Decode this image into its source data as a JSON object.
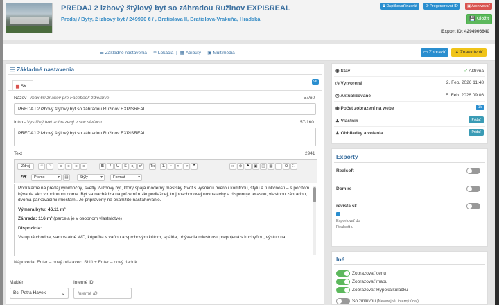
{
  "header": {
    "title": "PREDAJ 2 izbový štýlový byt so záhradou Ružinov EXPISREAL",
    "subtitle": "Predaj / Byty, 2 izbový byt / 249990 € / , Bratislava II, Bratislava-Vrakuňa, Hradská",
    "buttons": {
      "duplicate": "Duplikovať inzerát",
      "regenerate": "Pregenerovať ID",
      "archive": "Archivovať",
      "save": "Uložiť"
    },
    "export_id": "Export ID: 4294906640"
  },
  "nav": {
    "links": [
      "Základné nastavenia",
      "Lokácia",
      "Atribúty",
      "Multimédia"
    ],
    "separator": "|",
    "show_button": "Zobraziť",
    "unmark_button": "Znaektívniť"
  },
  "basic": {
    "title": "Základné nastavenia",
    "lang_tab": "SK",
    "lang_badge": "96",
    "name_label": "Názov",
    "name_hint": "max 60 znakov pre Facebook zdieľanie",
    "name_counter": "57/60",
    "name_value": "PREDAJ 2 izbový štýlový byt so záhradou Ružinov EXPISREAL",
    "intro_label": "Intro",
    "intro_hint": "Vystižný text zobrazený v soc.sieťach",
    "intro_counter": "57/160",
    "intro_value": "PREDAJ 2 izbový štýlový byt so záhradou Ružinov EXPISREAL",
    "text_label": "Text",
    "text_counter": "2941",
    "toolbar": {
      "source": "Zdroj",
      "font": "Písmo",
      "style": "Štýly",
      "format": "Formát"
    },
    "editor": [
      "Ponúkame na predaj výnimočný, svetlý 2-izbový byt, ktorý spája moderný mestský život s vysokou mierou komfortu, štýlu a funkčnosti – s pocitom bývania ako v rodinnom dome. Byt sa nachádza na prízemí nízkopodlažnej, trojposchodovej novostavby a disponuje terasou, vlastnou záhradou, dvoma parkovacími miestami. Je pripravený na okamžité nasťahovanie.",
      "Výmera bytu: 46,11 m²",
      "Záhrada: 116 m²",
      " (parcela je v osobnom vlastníctve)",
      "Dispozícia:",
      "Vstupná chodba, samostatné WC, kúpeľňa s vaňou a sprchovým kútom, spálňa, obývacia miestnosť prepojená s kuchyňou, výstup na"
    ],
    "editor_hint": "Nápoveda: Enter – nový odstavec, Shift + Enter – nový riadok",
    "agent_label": "Maklér",
    "agent_value": "Bc. Petra Hayek",
    "internal_id_label": "Interné ID",
    "internal_id_placeholder": "Interné ID"
  },
  "status": {
    "rows": [
      {
        "key": "Stav",
        "value": "Aktívna"
      },
      {
        "key": "Vytvorené",
        "value": "2. Feb. 2026 11:48"
      },
      {
        "key": "Aktualizované",
        "value": "5. Feb. 2026 09:06"
      },
      {
        "key": "Počet zobrazení na webe",
        "value": "1k"
      },
      {
        "key": "Vlastník",
        "value": "Pridať"
      },
      {
        "key": "Obhliadky a volania",
        "value": "Pridať"
      }
    ]
  },
  "exports": {
    "title": "Exporty",
    "items": [
      "Realsoft",
      "Domire",
      "revista.sk"
    ],
    "revista_note": "Exportovať do",
    "revista_note2": "Realsoft-u"
  },
  "other": {
    "title": "Iné",
    "items": [
      "Zobrazovať cenu",
      "Zobrazovať mapu",
      "Zobrazovať Hypokalkulačku",
      "So zmluvou"
    ],
    "contract_note": "(Neverejné, interný údaj)"
  },
  "colors": {
    "accent": "#3a6f9f",
    "link": "#2a8ecf",
    "success": "#5cb85c",
    "warning": "#f0c419",
    "danger": "#d9534f"
  }
}
